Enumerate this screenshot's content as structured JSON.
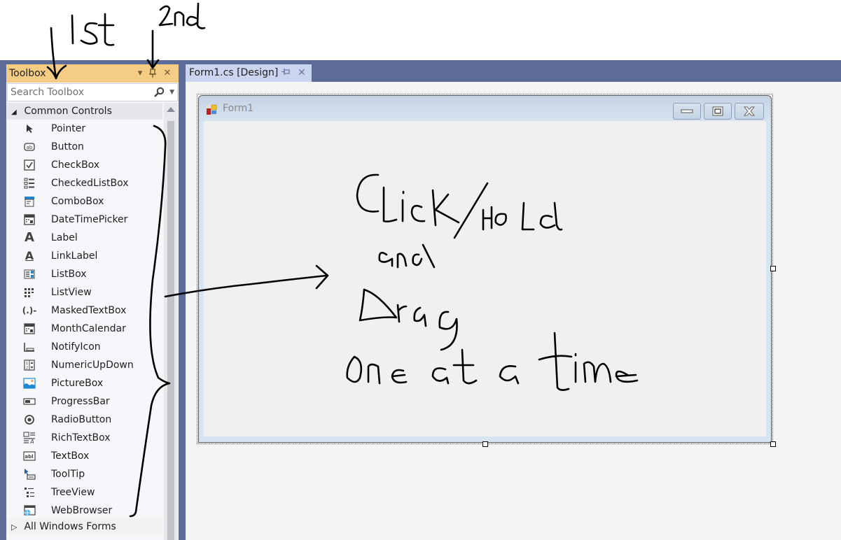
{
  "annotations": {
    "first_label": "1st",
    "second_label": "2nd",
    "instruction_lines": [
      "Click/Hold",
      "and",
      "Drag",
      "One at a time"
    ]
  },
  "toolbox": {
    "title": "Toolbox",
    "dropdown_icon": "dropdown-arrow-icon",
    "pin_icon": "pin-icon",
    "close_icon": "close-icon",
    "search_placeholder": "Search Toolbox",
    "search_value": "",
    "categories": [
      {
        "label": "Common Controls",
        "expanded": true,
        "items": [
          {
            "label": "Pointer",
            "icon": "pointer-icon"
          },
          {
            "label": "Button",
            "icon": "button-icon"
          },
          {
            "label": "CheckBox",
            "icon": "checkbox-icon"
          },
          {
            "label": "CheckedListBox",
            "icon": "checkedlistbox-icon"
          },
          {
            "label": "ComboBox",
            "icon": "combobox-icon"
          },
          {
            "label": "DateTimePicker",
            "icon": "datetimepicker-icon"
          },
          {
            "label": "Label",
            "icon": "label-icon"
          },
          {
            "label": "LinkLabel",
            "icon": "linklabel-icon"
          },
          {
            "label": "ListBox",
            "icon": "listbox-icon"
          },
          {
            "label": "ListView",
            "icon": "listview-icon"
          },
          {
            "label": "MaskedTextBox",
            "icon": "maskedtextbox-icon"
          },
          {
            "label": "MonthCalendar",
            "icon": "monthcalendar-icon"
          },
          {
            "label": "NotifyIcon",
            "icon": "notifyicon-icon"
          },
          {
            "label": "NumericUpDown",
            "icon": "numericupdown-icon"
          },
          {
            "label": "PictureBox",
            "icon": "picturebox-icon"
          },
          {
            "label": "ProgressBar",
            "icon": "progressbar-icon"
          },
          {
            "label": "RadioButton",
            "icon": "radiobutton-icon"
          },
          {
            "label": "RichTextBox",
            "icon": "richtextbox-icon"
          },
          {
            "label": "TextBox",
            "icon": "textbox-icon"
          },
          {
            "label": "ToolTip",
            "icon": "tooltip-icon"
          },
          {
            "label": "TreeView",
            "icon": "treeview-icon"
          },
          {
            "label": "WebBrowser",
            "icon": "webbrowser-icon"
          }
        ]
      },
      {
        "label": "All Windows Forms",
        "expanded": false
      }
    ]
  },
  "document": {
    "tab_label": "Form1.cs [Design]",
    "form_title": "Form1"
  },
  "colors": {
    "ide_frame": "#5d6b99",
    "toolbox_header": "#f5cc84",
    "doc_tab": "#ccd5f0"
  }
}
